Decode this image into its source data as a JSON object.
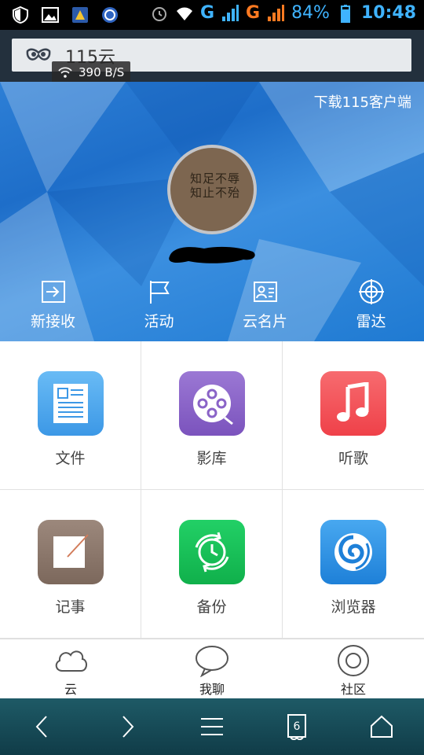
{
  "status_bar": {
    "network_1": "G",
    "network_2": "G",
    "battery": "84%",
    "time": "10:48",
    "icons": [
      "shield-icon",
      "image-icon",
      "app-icon",
      "shield-badge-icon",
      "alarm-icon",
      "wifi-icon",
      "signal-icon",
      "battery-icon"
    ]
  },
  "address_bar": {
    "text": "115云",
    "speed": "390 B/S"
  },
  "profile": {
    "download_link": "下载115客户端",
    "avatar_text": "知足不辱知止不殆"
  },
  "quick_actions": [
    {
      "label": "新接收",
      "icon": "inbox-icon"
    },
    {
      "label": "活动",
      "icon": "flag-icon"
    },
    {
      "label": "云名片",
      "icon": "contact-card-icon"
    },
    {
      "label": "雷达",
      "icon": "radar-icon"
    }
  ],
  "apps": [
    {
      "label": "文件",
      "icon": "file-icon",
      "color": "#4aa8ef"
    },
    {
      "label": "影库",
      "icon": "film-reel-icon",
      "color": "#8a63c7"
    },
    {
      "label": "听歌",
      "icon": "music-note-icon",
      "color": "#f4545a"
    },
    {
      "label": "记事",
      "icon": "note-icon",
      "color": "#8b776b"
    },
    {
      "label": "备份",
      "icon": "backup-clock-icon",
      "color": "#19c057"
    },
    {
      "label": "浏览器",
      "icon": "browser-swirl-icon",
      "color": "#2b91e6"
    }
  ],
  "bottom_tabs": [
    {
      "label": "云",
      "icon": "cloud-icon"
    },
    {
      "label": "我聊",
      "icon": "chat-bubble-icon"
    },
    {
      "label": "社区",
      "icon": "community-circle-icon"
    }
  ],
  "nav_bar": {
    "tabs_count": "6",
    "icons": [
      "back-icon",
      "forward-icon",
      "menu-icon",
      "tabs-icon",
      "home-icon"
    ]
  }
}
